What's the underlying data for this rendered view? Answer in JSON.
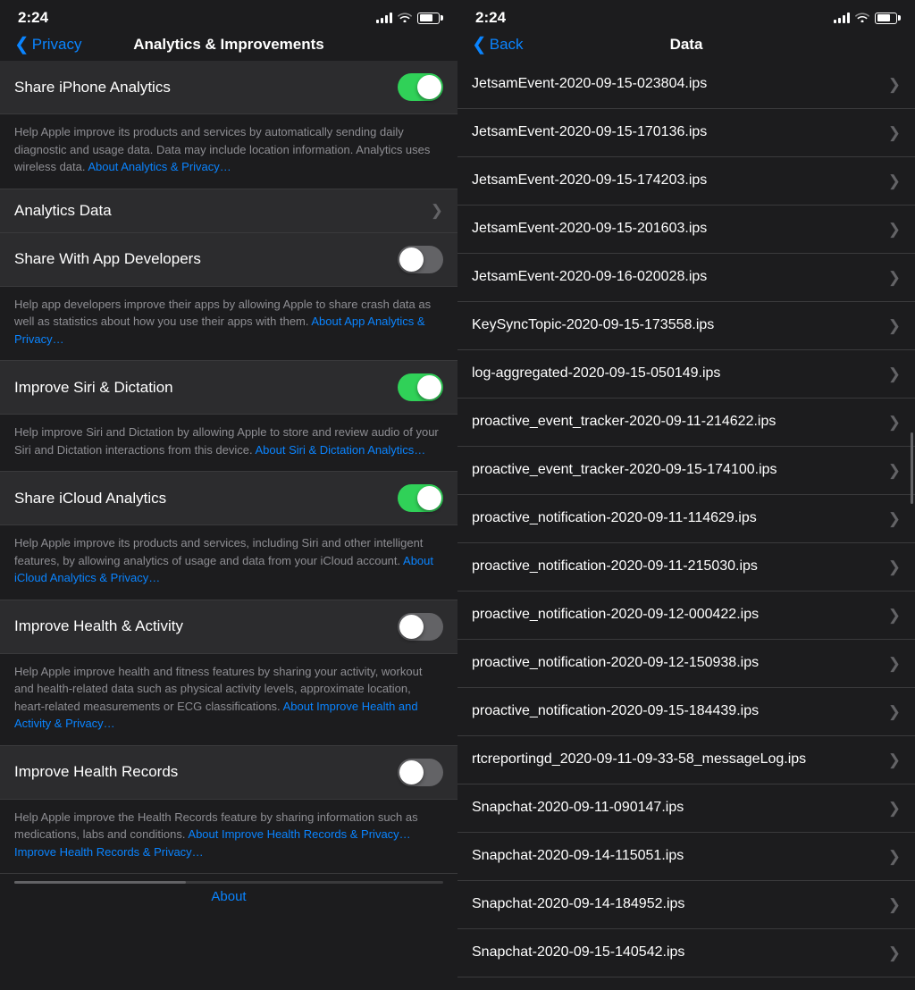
{
  "left": {
    "statusBar": {
      "time": "2:24"
    },
    "navBack": "Privacy",
    "navTitle": "Analytics & Improvements",
    "sections": [
      {
        "id": "share-iphone-analytics",
        "label": "Share iPhone Analytics",
        "type": "toggle",
        "on": true,
        "description": "Help Apple improve its products and services by automatically sending daily diagnostic and usage data. Data may include location information. Analytics uses wireless data.",
        "linkText": "About Analytics & Privacy…",
        "hasLink": true
      },
      {
        "id": "analytics-data",
        "label": "Analytics Data",
        "type": "link"
      },
      {
        "id": "share-with-app-developers",
        "label": "Share With App Developers",
        "type": "toggle",
        "on": false,
        "description": "Help app developers improve their apps by allowing Apple to share crash data as well as statistics about how you use their apps with them.",
        "linkText": "About App Analytics & Privacy…",
        "hasLink": true
      },
      {
        "id": "improve-siri-dictation",
        "label": "Improve Siri & Dictation",
        "type": "toggle",
        "on": true,
        "description": "Help improve Siri and Dictation by allowing Apple to store and review audio of your Siri and Dictation interactions from this device.",
        "linkText": "About Siri & Dictation Analytics…",
        "hasLink": true
      },
      {
        "id": "share-icloud-analytics",
        "label": "Share iCloud Analytics",
        "type": "toggle",
        "on": true,
        "description": "Help Apple improve its products and services, including Siri and other intelligent features, by allowing analytics of usage and data from your iCloud account.",
        "linkText": "About iCloud Analytics & Privacy…",
        "hasLink": true
      },
      {
        "id": "improve-health-activity",
        "label": "Improve Health & Activity",
        "type": "toggle",
        "on": false,
        "description": "Help Apple improve health and fitness features by sharing your activity, workout and health-related data such as physical activity levels, approximate location, heart-related measurements or ECG classifications.",
        "linkText": "About Improve Health and Activity & Privacy…",
        "hasLink": true
      },
      {
        "id": "improve-health-records",
        "label": "Improve Health Records",
        "type": "toggle",
        "on": false,
        "description": "Help Apple improve the Health Records feature by sharing information such as medications, labs and conditions.",
        "linkText": "About Improve Health Records & Privacy…",
        "hasLink": true
      }
    ],
    "aboutLink": "About"
  },
  "right": {
    "statusBar": {
      "time": "2:24"
    },
    "navBack": "Back",
    "navTitle": "Data",
    "files": [
      "JetsamEvent-2020-09-15-023804.ips",
      "JetsamEvent-2020-09-15-170136.ips",
      "JetsamEvent-2020-09-15-174203.ips",
      "JetsamEvent-2020-09-15-201603.ips",
      "JetsamEvent-2020-09-16-020028.ips",
      "KeySyncTopic-2020-09-15-173558.ips",
      "log-aggregated-2020-09-15-050149.ips",
      "proactive_event_tracker-2020-09-11-214622.ips",
      "proactive_event_tracker-2020-09-15-174100.ips",
      "proactive_notification-2020-09-11-114629.ips",
      "proactive_notification-2020-09-11-215030.ips",
      "proactive_notification-2020-09-12-000422.ips",
      "proactive_notification-2020-09-12-150938.ips",
      "proactive_notification-2020-09-15-184439.ips",
      "rtcreportingd_2020-09-11-09-33-58_messageLog.ips",
      "Snapchat-2020-09-11-090147.ips",
      "Snapchat-2020-09-14-115051.ips",
      "Snapchat-2020-09-14-184952.ips",
      "Snapchat-2020-09-15-140542.ips"
    ]
  }
}
